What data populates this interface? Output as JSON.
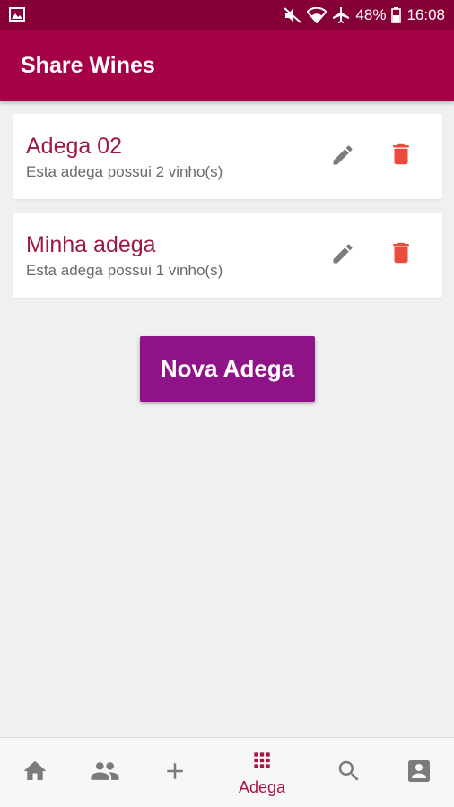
{
  "status_bar": {
    "battery": "48%",
    "time": "16:08",
    "icons": [
      "image-icon",
      "mute-icon",
      "wifi-icon",
      "airplane-icon",
      "battery-icon"
    ]
  },
  "app_bar": {
    "title": "Share Wines"
  },
  "cellars": [
    {
      "name": "Adega 02",
      "description": "Esta adega possui 2 vinho(s)"
    },
    {
      "name": "Minha adega",
      "description": "Esta adega possui 1 vinho(s)"
    }
  ],
  "new_cellar_button": {
    "label": "Nova Adega"
  },
  "bottom_nav": {
    "items": [
      {
        "icon": "home-icon",
        "label": ""
      },
      {
        "icon": "people-icon",
        "label": ""
      },
      {
        "icon": "add-icon",
        "label": ""
      },
      {
        "icon": "grid-icon",
        "label": "Adega",
        "active": true
      },
      {
        "icon": "search-icon",
        "label": ""
      },
      {
        "icon": "profile-icon",
        "label": ""
      }
    ]
  },
  "colors": {
    "status_bar": "#850036",
    "app_bar": "#a60046",
    "accent_text": "#9c1947",
    "button": "#8f1387",
    "delete": "#ea4b3c",
    "icon_gray": "#7b7b7b"
  }
}
